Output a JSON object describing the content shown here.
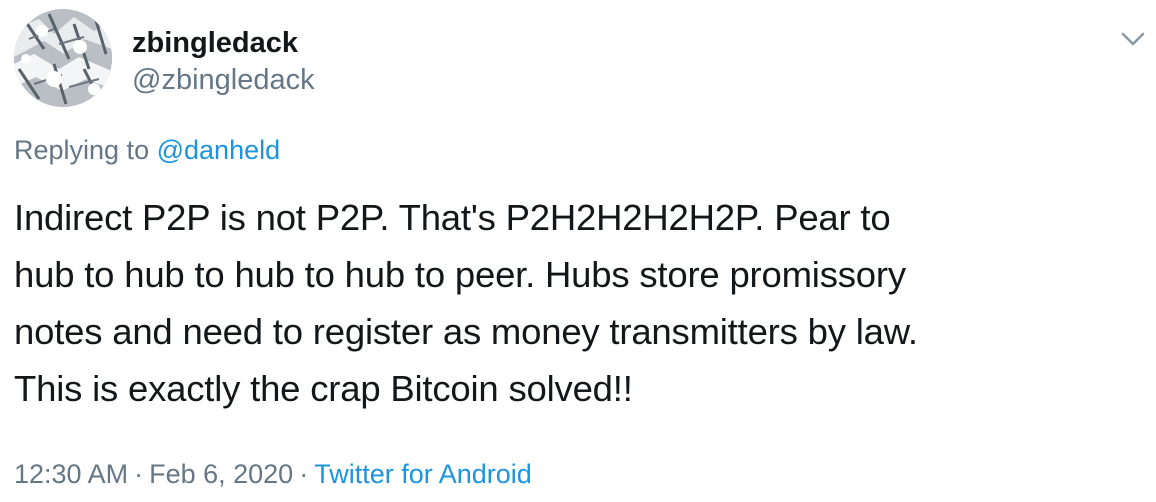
{
  "author": {
    "display_name": "zbingledack",
    "handle": "@zbingledack"
  },
  "reply_context": {
    "prefix": "Replying to",
    "mention": "@danheld"
  },
  "tweet": {
    "lines": [
      "Indirect P2P is not P2P. That's P2H2H2H2H2P. Pear to",
      "hub to hub to hub to hub to peer. Hubs store promissory",
      "notes and need to register as money transmitters by law.",
      "This is exactly the crap Bitcoin solved!!"
    ]
  },
  "meta": {
    "time": "12:30 AM",
    "separator": "·",
    "date": "Feb 6, 2020",
    "source": "Twitter for Android"
  },
  "icons": {
    "menu": "chevron-down-icon",
    "avatar": "snowy-tree-avatar"
  },
  "colors": {
    "text_primary": "#14171a",
    "text_secondary": "#657786",
    "link": "#1b95e0",
    "chevron": "#8899a6"
  }
}
